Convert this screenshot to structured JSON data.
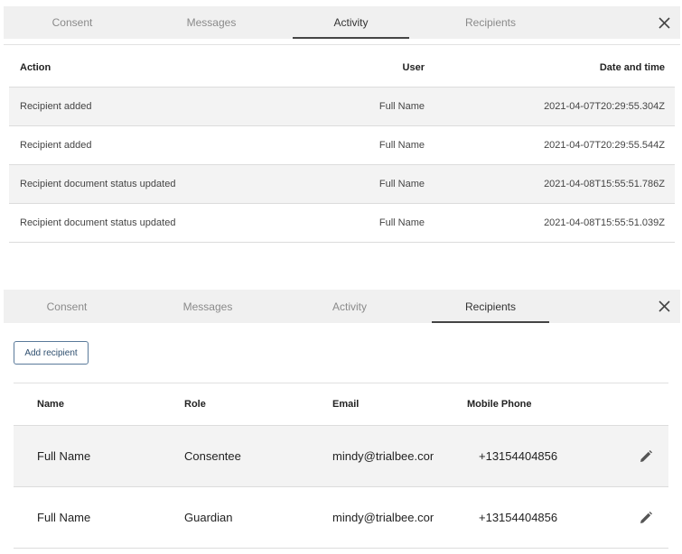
{
  "activity_panel": {
    "tabs": [
      {
        "label": "Consent"
      },
      {
        "label": "Messages"
      },
      {
        "label": "Activity"
      },
      {
        "label": "Recipients"
      }
    ],
    "active_tab": "Activity",
    "table": {
      "headers": {
        "action": "Action",
        "user": "User",
        "date": "Date and time"
      },
      "rows": [
        {
          "action": "Recipient added",
          "user": "Full Name",
          "date": "2021-04-07T20:29:55.304Z"
        },
        {
          "action": "Recipient added",
          "user": "Full Name",
          "date": "2021-04-07T20:29:55.544Z"
        },
        {
          "action": "Recipient document status updated",
          "user": "Full Name",
          "date": "2021-04-08T15:55:51.786Z"
        },
        {
          "action": "Recipient document status updated",
          "user": "Full Name",
          "date": "2021-04-08T15:55:51.039Z"
        }
      ]
    }
  },
  "recipients_panel": {
    "tabs": [
      {
        "label": "Consent"
      },
      {
        "label": "Messages"
      },
      {
        "label": "Activity"
      },
      {
        "label": "Recipients"
      }
    ],
    "active_tab": "Recipients",
    "add_button_label": "Add recipient",
    "table": {
      "headers": {
        "name": "Name",
        "role": "Role",
        "email": "Email",
        "phone": "Mobile Phone"
      },
      "rows": [
        {
          "name": "Full Name",
          "role": "Consentee",
          "email": "mindy@trialbee.com",
          "phone": "+13154404856"
        },
        {
          "name": "Full Name",
          "role": "Guardian",
          "email": "mindy@trialbee.com",
          "phone": "+13154404856"
        }
      ]
    }
  },
  "icons": {
    "close": "close-icon",
    "edit": "pencil-icon"
  },
  "colors": {
    "tab_bar": "#f0f0f0",
    "active_underline": "#444444",
    "row_shade": "#f3f3f3",
    "button_border": "#5a7a9a"
  }
}
